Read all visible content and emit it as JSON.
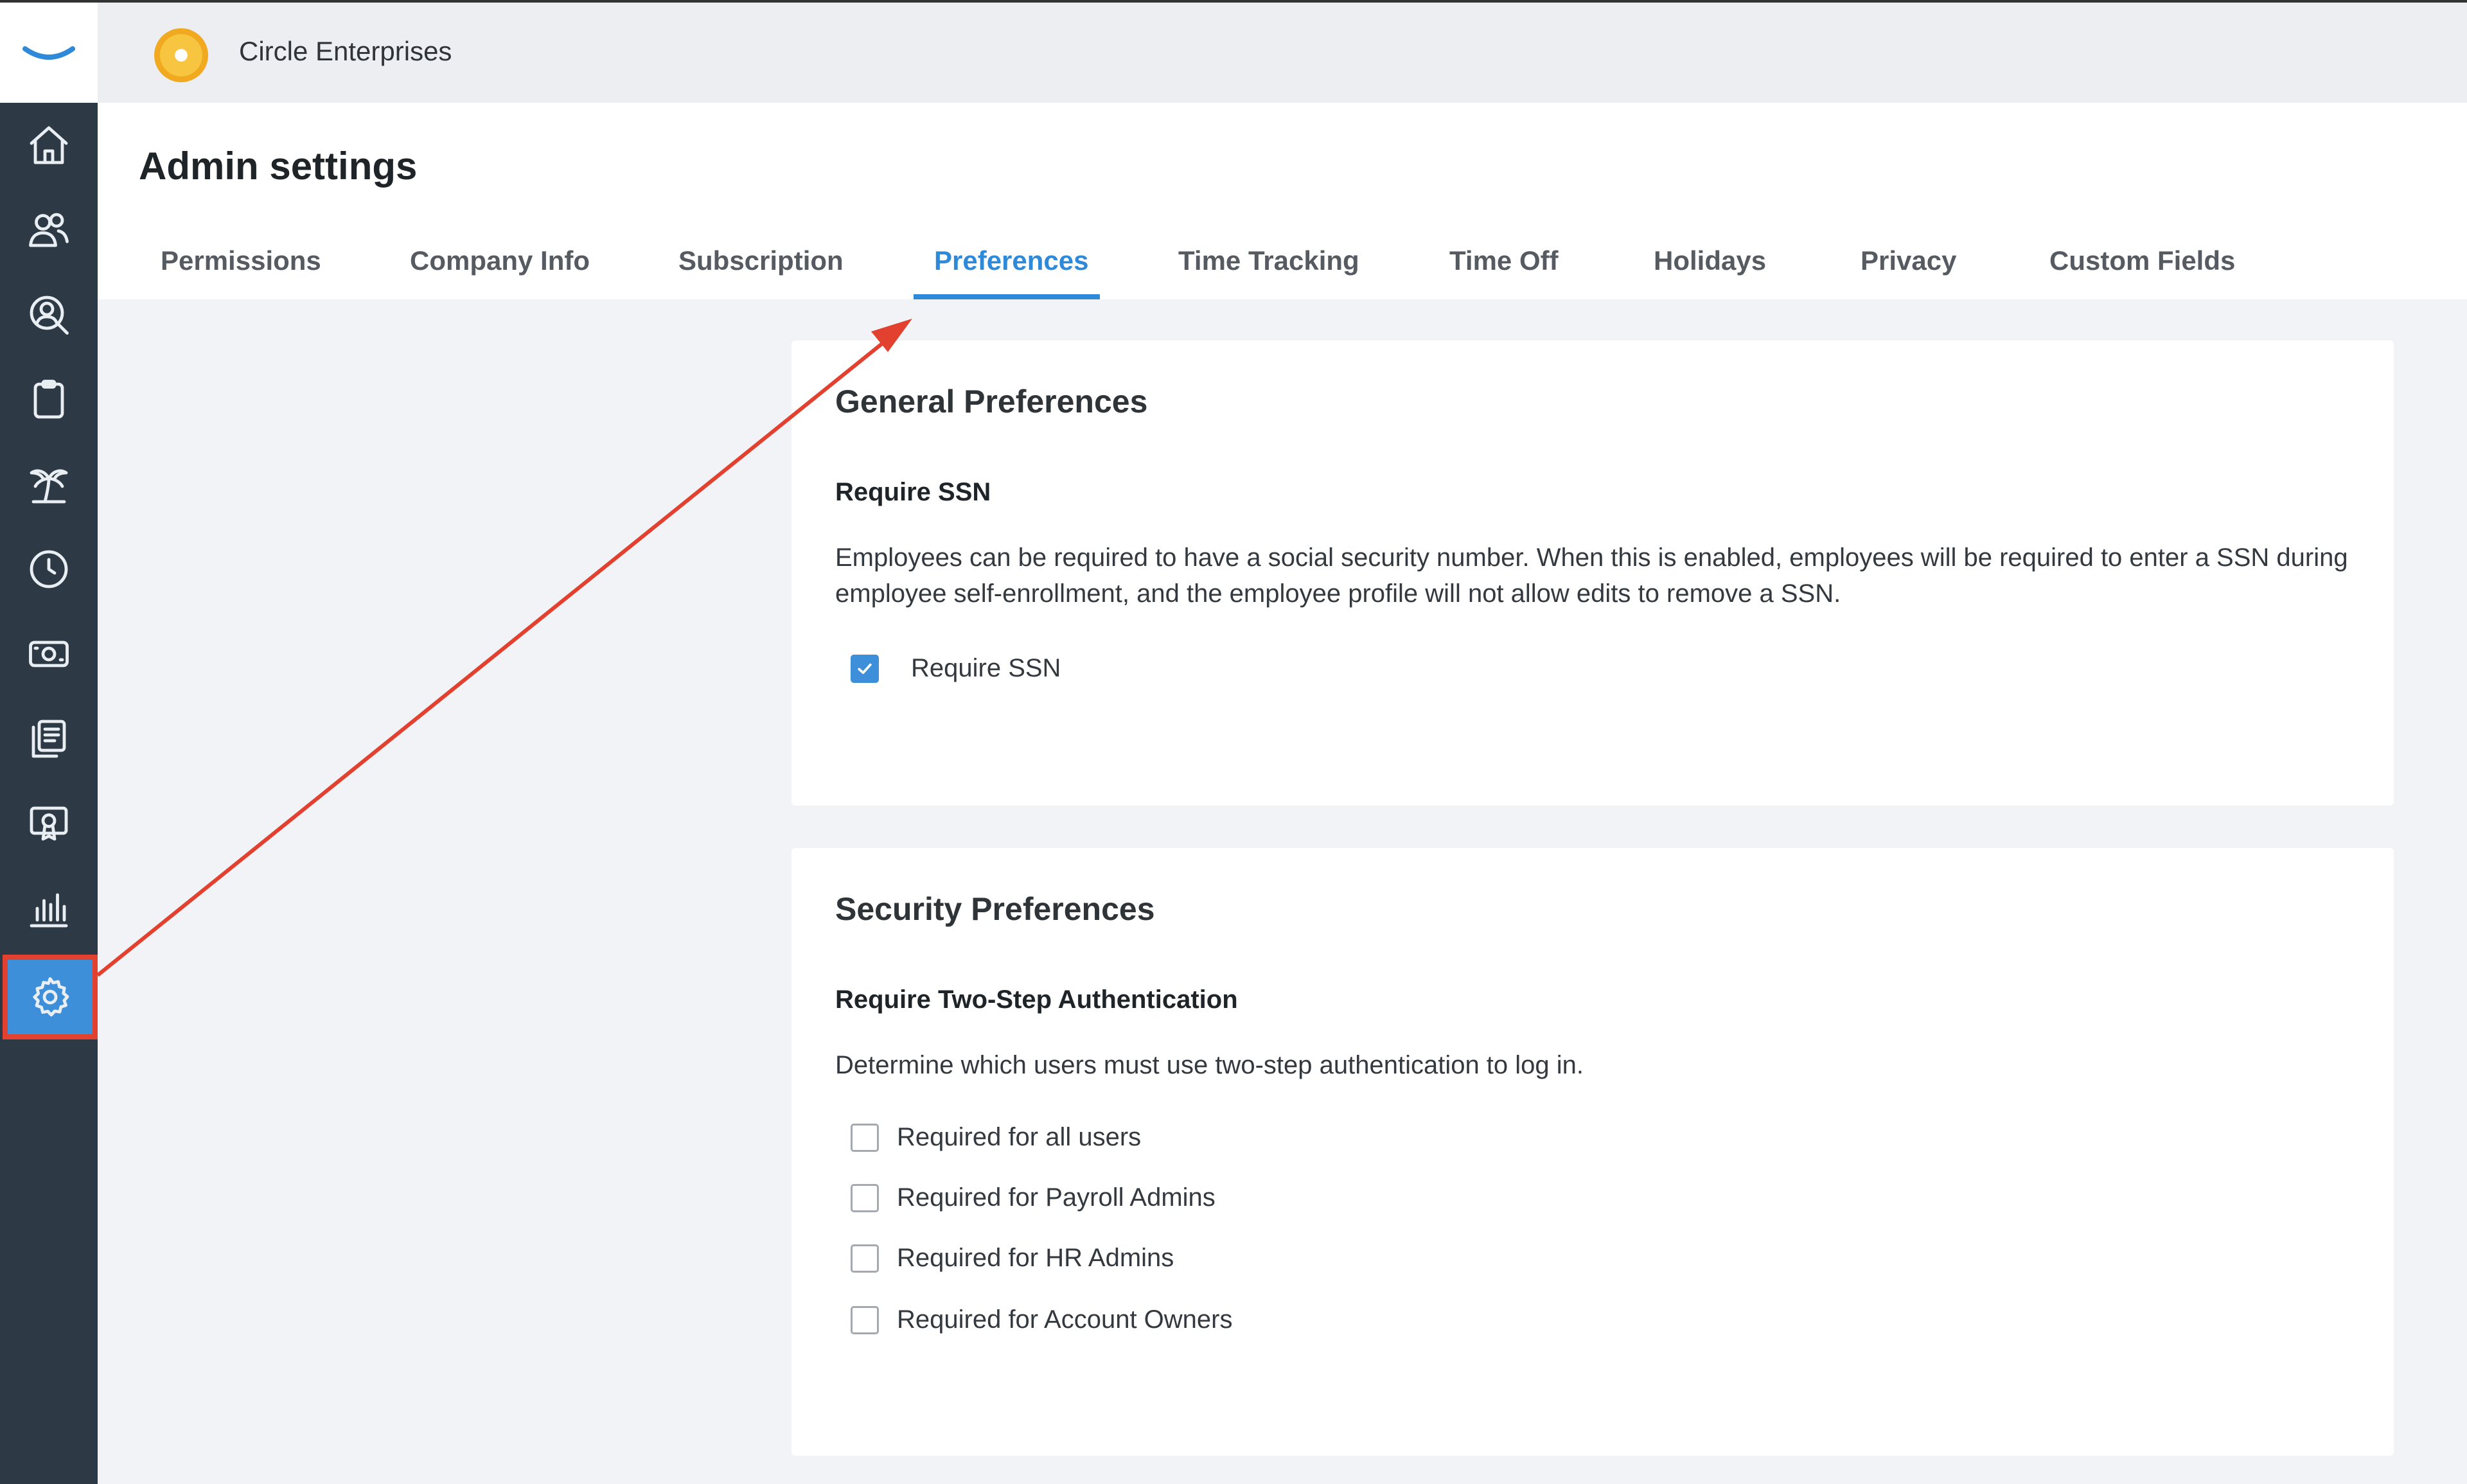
{
  "company": {
    "name": "Circle Enterprises"
  },
  "page": {
    "title": "Admin settings"
  },
  "tabs": [
    {
      "label": "Permissions"
    },
    {
      "label": "Company Info"
    },
    {
      "label": "Subscription"
    },
    {
      "label": "Preferences"
    },
    {
      "label": "Time Tracking"
    },
    {
      "label": "Time Off"
    },
    {
      "label": "Holidays"
    },
    {
      "label": "Privacy"
    },
    {
      "label": "Custom Fields"
    }
  ],
  "active_tab": "Preferences",
  "sidebar": {
    "icons": [
      "home-icon",
      "people-icon",
      "person-search-icon",
      "clipboard-icon",
      "palm-tree-icon",
      "clock-icon",
      "money-icon",
      "documents-icon",
      "certificate-icon",
      "bar-chart-icon",
      "gear-icon"
    ],
    "active": "gear-icon"
  },
  "general": {
    "title": "General Preferences",
    "subtitle": "Require SSN",
    "description": "Employees can be required to have a social security number. When this is enabled, employees will be required to enter a SSN during employee self-enrollment, and the employee profile will not allow edits to remove a SSN.",
    "option": {
      "label": "Require SSN",
      "checked": true
    }
  },
  "security": {
    "title": "Security Preferences",
    "subtitle": "Require Two-Step Authentication",
    "description": "Determine which users must use two-step authentication to log in.",
    "options": [
      {
        "label": "Required for all users",
        "checked": false
      },
      {
        "label": "Required for Payroll Admins",
        "checked": false
      },
      {
        "label": "Required for HR Admins",
        "checked": false
      },
      {
        "label": "Required for Account Owners",
        "checked": false
      }
    ]
  },
  "colors": {
    "accent": "#3d8fd9",
    "sidebar": "#2d3945",
    "annotation": "#e2412f"
  }
}
